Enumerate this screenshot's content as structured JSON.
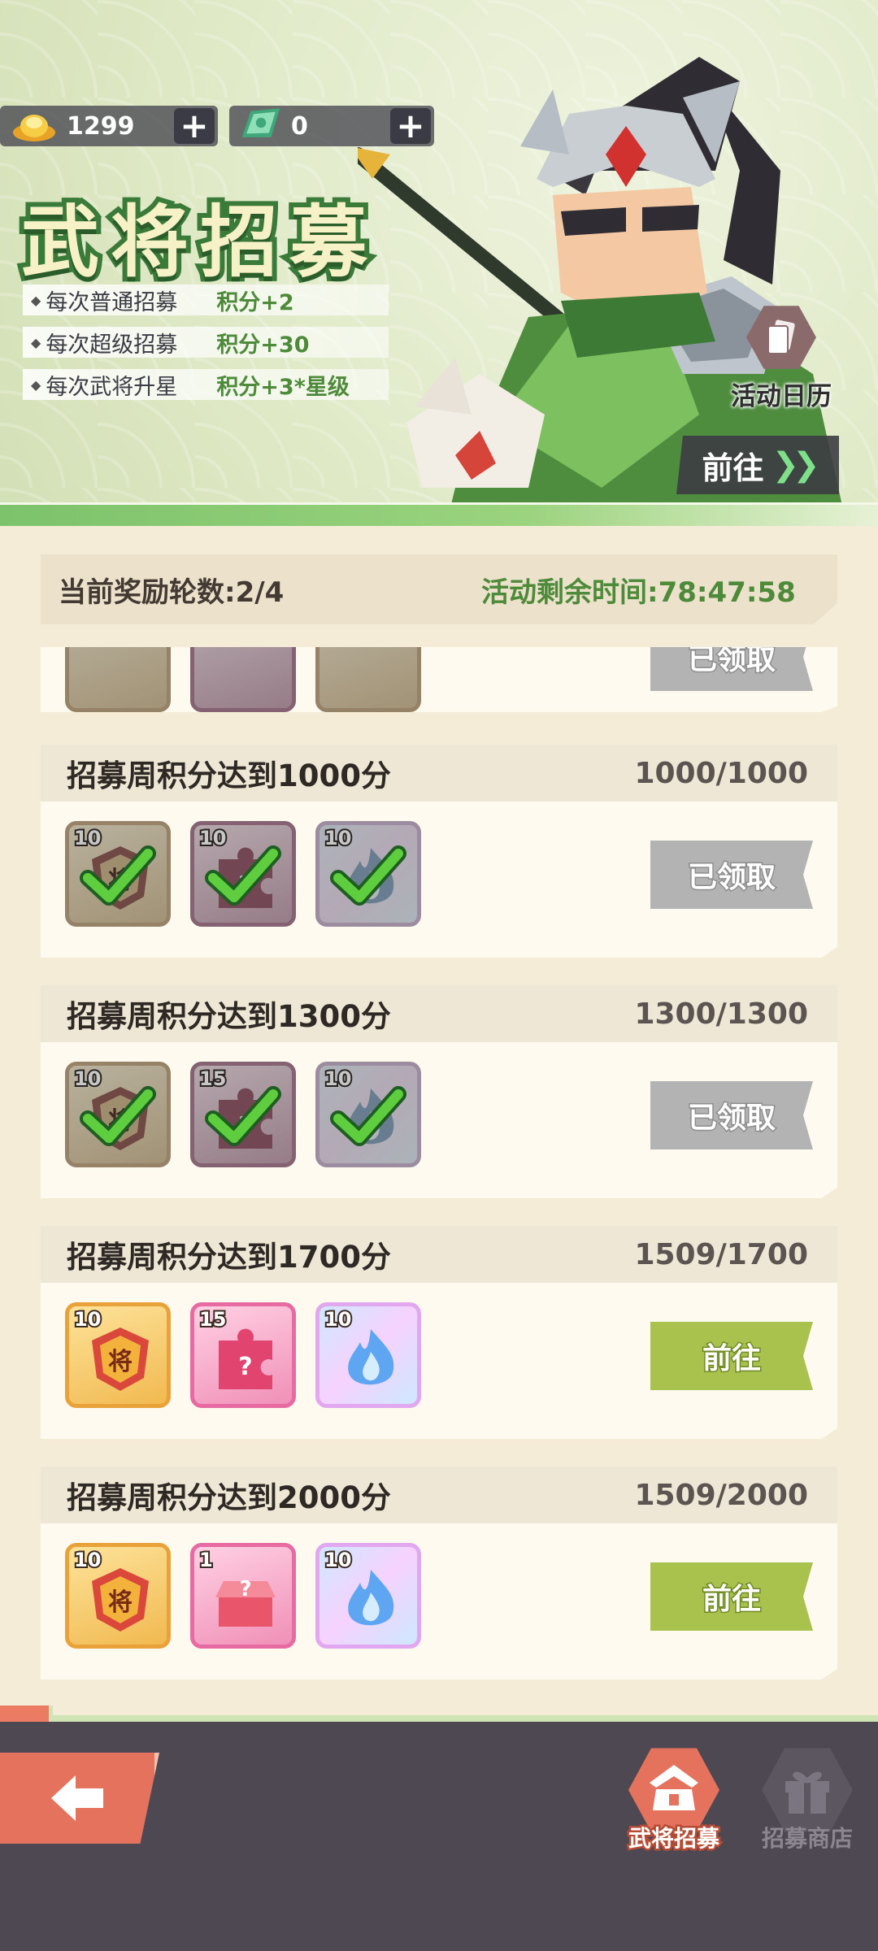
{
  "colors": {
    "accent_green": "#4d8a3a",
    "claimed_button": "#b3b3b3",
    "goto_button": "#a9c24e",
    "back_button": "#e4725d"
  },
  "currency": [
    {
      "icon": "gold-ingot-icon",
      "value": "1299"
    },
    {
      "icon": "recruit-ticket-icon",
      "value": "0"
    }
  ],
  "banner": {
    "title": "武将招募",
    "rules": [
      {
        "text": "每次普通招募",
        "points": "积分+2"
      },
      {
        "text": "每次超级招募",
        "points": "积分+30"
      },
      {
        "text": "每次武将升星",
        "points": "积分+3*星级"
      }
    ],
    "calendar_label": "活动日历",
    "goto_label": "前往"
  },
  "info": {
    "round": "当前奖励轮数:2/4",
    "time_left": "活动剩余时间:78:47:58"
  },
  "milestones": [
    {
      "title": "招募周积分达到1000分",
      "progress": "1000/1000",
      "status": "已领取",
      "state": "claimed",
      "rewards": [
        {
          "icon": "general-token-icon",
          "count": "10",
          "style": "gold"
        },
        {
          "icon": "puzzle-piece-icon",
          "count": "10",
          "style": "pink"
        },
        {
          "icon": "blue-flame-icon",
          "count": "10",
          "style": "holo"
        }
      ]
    },
    {
      "title": "招募周积分达到1300分",
      "progress": "1300/1300",
      "status": "已领取",
      "state": "claimed",
      "rewards": [
        {
          "icon": "general-token-icon",
          "count": "10",
          "style": "gold"
        },
        {
          "icon": "puzzle-piece-icon",
          "count": "15",
          "style": "pink"
        },
        {
          "icon": "blue-flame-icon",
          "count": "10",
          "style": "holo"
        }
      ]
    },
    {
      "title": "招募周积分达到1700分",
      "progress": "1509/1700",
      "status": "前往",
      "state": "go",
      "rewards": [
        {
          "icon": "general-token-icon",
          "count": "10",
          "style": "gold"
        },
        {
          "icon": "puzzle-piece-icon",
          "count": "15",
          "style": "pink"
        },
        {
          "icon": "blue-flame-icon",
          "count": "10",
          "style": "holo"
        }
      ]
    },
    {
      "title": "招募周积分达到2000分",
      "progress": "1509/2000",
      "status": "前往",
      "state": "go",
      "rewards": [
        {
          "icon": "general-token-icon",
          "count": "10",
          "style": "gold"
        },
        {
          "icon": "mystery-box-icon",
          "count": "1",
          "style": "pink"
        },
        {
          "icon": "blue-flame-icon",
          "count": "10",
          "style": "holo"
        }
      ]
    }
  ],
  "nav": [
    {
      "label": "武将招募",
      "icon": "recruit-hat-icon",
      "active": true
    },
    {
      "label": "招募商店",
      "icon": "gift-box-icon",
      "active": false
    }
  ]
}
